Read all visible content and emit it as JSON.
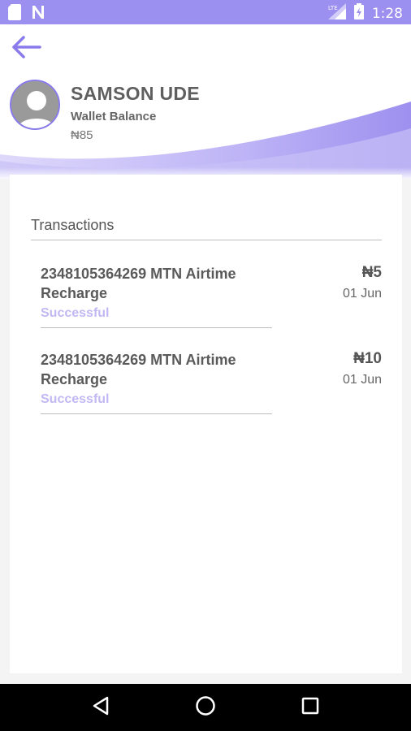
{
  "status_bar": {
    "time": "1:28",
    "network": "LTE"
  },
  "header": {
    "user_name": "SAMSON UDE",
    "wallet_label": "Wallet Balance",
    "wallet_balance": "₦85"
  },
  "transactions": {
    "title": "Transactions",
    "items": [
      {
        "description": "2348105364269 MTN Airtime Recharge",
        "status": "Successful",
        "amount": "₦5",
        "date": "01 Jun"
      },
      {
        "description": "2348105364269 MTN Airtime Recharge",
        "status": "Successful",
        "amount": "₦10",
        "date": "01 Jun"
      }
    ]
  },
  "colors": {
    "accent": "#8a7bec",
    "status_bar": "#9b8fef",
    "success": "#c2b8f3"
  },
  "icons": {
    "back": "arrow-left-icon",
    "nav_back": "triangle-back-icon",
    "nav_home": "circle-home-icon",
    "nav_recents": "square-recents-icon"
  }
}
